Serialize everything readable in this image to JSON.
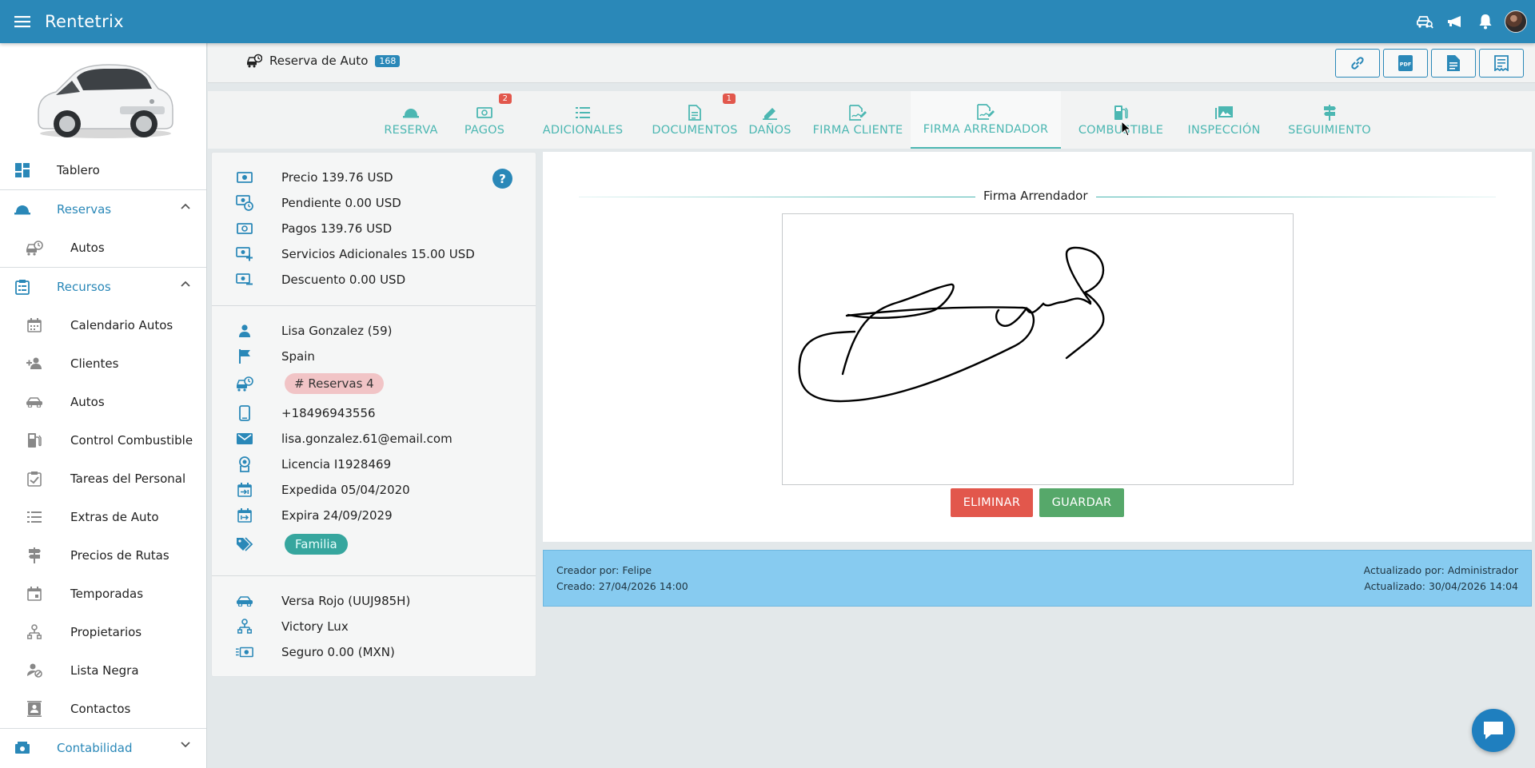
{
  "app": {
    "title": "Rentetrix"
  },
  "sidebar": {
    "items": [
      {
        "label": "Tablero"
      },
      {
        "label": "Reservas"
      },
      {
        "label": "Autos"
      },
      {
        "label": "Recursos"
      },
      {
        "label": "Calendario Autos"
      },
      {
        "label": "Clientes"
      },
      {
        "label": "Autos"
      },
      {
        "label": "Control Combustible"
      },
      {
        "label": "Tareas del Personal"
      },
      {
        "label": "Extras de Auto"
      },
      {
        "label": "Precios de Rutas"
      },
      {
        "label": "Temporadas"
      },
      {
        "label": "Propietarios"
      },
      {
        "label": "Lista Negra"
      },
      {
        "label": "Contactos"
      },
      {
        "label": "Contabilidad"
      }
    ]
  },
  "header": {
    "title": "Reserva de Auto",
    "badge": "168"
  },
  "tabs": [
    {
      "label": "RESERVA"
    },
    {
      "label": "PAGOS",
      "count": "2"
    },
    {
      "label": "ADICIONALES"
    },
    {
      "label": "DOCUMENTOS",
      "count": "1"
    },
    {
      "label": "DAÑOS"
    },
    {
      "label": "FIRMA CLIENTE"
    },
    {
      "label": "FIRMA ARRENDADOR"
    },
    {
      "label": "COMBUSTIBLE"
    },
    {
      "label": "INSPECCIÓN"
    },
    {
      "label": "SEGUIMIENTO"
    }
  ],
  "summary": {
    "precio": "Precio 139.76 USD",
    "pendiente": "Pendiente 0.00 USD",
    "pagos": "Pagos 139.76 USD",
    "servicios": "Servicios Adicionales 15.00 USD",
    "descuento": "Descuento 0.00 USD",
    "help": "?"
  },
  "customer": {
    "name": "Lisa Gonzalez (59)",
    "country": "Spain",
    "reservations": "# Reservas 4",
    "phone": "+18496943556",
    "email": "lisa.gonzalez.61@email.com",
    "license": "Licencia I1928469",
    "issued": "Expedida 05/04/2020",
    "expires": "Expira 24/09/2029",
    "tag": "Familia"
  },
  "vehicle": {
    "car": "Versa Rojo (UUJ985H)",
    "owner": "Victory Lux",
    "insurance": "Seguro 0.00 (MXN)"
  },
  "signature": {
    "legend": "Firma Arrendador",
    "delete_label": "ELIMINAR",
    "save_label": "GUARDAR"
  },
  "audit": {
    "created_by": "Creador por: Felipe",
    "created_at": "Creado: 27/04/2026 14:00",
    "updated_by": "Actualizado por: Administrador",
    "updated_at": "Actualizado: 30/04/2026 14:04"
  },
  "colors": {
    "primary": "#2a88b8",
    "accent": "#4cb7b2",
    "danger": "#e2574c",
    "success": "#56a86a",
    "audit_bg": "#87cbf0"
  },
  "icons": {
    "topbar": [
      "menu-icon",
      "car-search-icon",
      "horn-icon",
      "bell-icon",
      "avatar"
    ],
    "header_actions": [
      "link-icon",
      "pdf-icon",
      "document-icon",
      "receipt-icon"
    ]
  }
}
